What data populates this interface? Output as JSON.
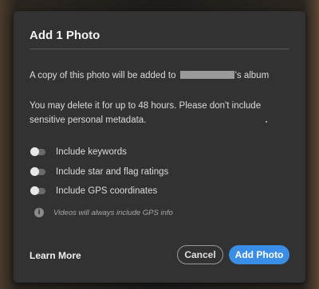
{
  "dialog": {
    "title": "Add 1 Photo",
    "message_prefix": "A copy of this photo will be added to",
    "message_suffix": "'s album",
    "deletion_notice": "You may delete it for up to 48 hours. Please don't include sensitive personal metadata.",
    "options": [
      {
        "label": "Include keywords",
        "enabled": false
      },
      {
        "label": "Include star and flag ratings",
        "enabled": false
      },
      {
        "label": "Include GPS coordinates",
        "enabled": false
      }
    ],
    "info_icon": "info-icon",
    "info_text": "Videos will always include GPS info",
    "learn_more": "Learn More",
    "cancel_label": "Cancel",
    "add_label": "Add Photo"
  },
  "colors": {
    "dialog_bg": "#323232",
    "accent": "#3a8ee6"
  }
}
